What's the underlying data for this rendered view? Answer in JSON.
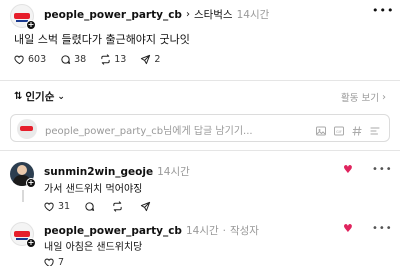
{
  "post": {
    "username": "people_power_party_cb",
    "topic": "스타벅스",
    "time": "14시간",
    "text": "내일 스벅 들렸다가 출근해야지 굿나잇",
    "likes": "603",
    "comments": "38",
    "reposts": "13",
    "shares": "2"
  },
  "sort": {
    "label": "인기순",
    "activity_label": "활동 보기"
  },
  "reply": {
    "placeholder": "people_power_party_cb님에게 답글 남기기..."
  },
  "comments": [
    {
      "username": "sunmin2win_geoje",
      "time": "14시간",
      "text": "가서 샌드위치 먹어야징",
      "likes": "31"
    },
    {
      "username": "people_power_party_cb",
      "time": "14시간",
      "author_badge": "작성자",
      "text": "내일 아침은 샌드위치당",
      "likes": "7"
    }
  ],
  "colors": {
    "brand_red": "#e61e2b",
    "like_red": "#e0245e",
    "muted": "#999999"
  }
}
